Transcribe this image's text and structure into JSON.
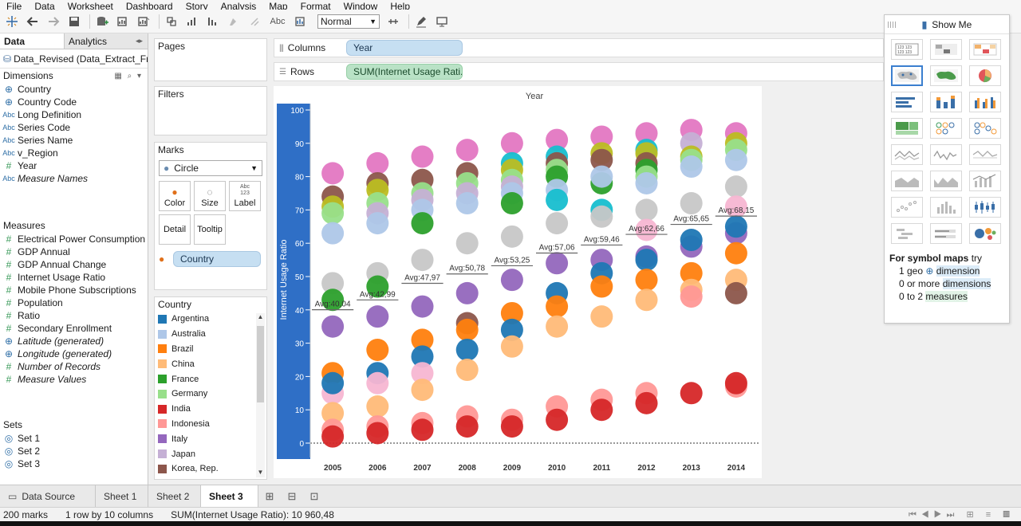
{
  "menu": [
    "File",
    "Data",
    "Worksheet",
    "Dashboard",
    "Story",
    "Analysis",
    "Map",
    "Format",
    "Window",
    "Help"
  ],
  "toolbar": {
    "fit_value": "Normal",
    "text_label": "Abc"
  },
  "data_pane": {
    "tab_data": "Data",
    "tab_analytics": "Analytics",
    "datasource": "Data_Revised (Data_Extract_Fr...",
    "dimensions_title": "Dimensions",
    "dimensions": [
      {
        "type": "geo",
        "name": "Country",
        "italic": false
      },
      {
        "type": "geo",
        "name": "Country Code",
        "italic": false
      },
      {
        "type": "abc",
        "name": "Long Definition",
        "italic": false
      },
      {
        "type": "abc",
        "name": "Series Code",
        "italic": false
      },
      {
        "type": "abc",
        "name": "Series Name",
        "italic": false
      },
      {
        "type": "abc",
        "name": "v_Region",
        "italic": false
      },
      {
        "type": "num",
        "name": "Year",
        "italic": false
      },
      {
        "type": "abc",
        "name": "Measure Names",
        "italic": true
      }
    ],
    "measures_title": "Measures",
    "measures": [
      {
        "type": "num",
        "name": "Electrical Power Consumption",
        "italic": false
      },
      {
        "type": "num",
        "name": "GDP Annual",
        "italic": false
      },
      {
        "type": "num",
        "name": "GDP Annual Change",
        "italic": false
      },
      {
        "type": "num",
        "name": "Internet Usage Ratio",
        "italic": false
      },
      {
        "type": "num",
        "name": "Mobile Phone Subscriptions",
        "italic": false
      },
      {
        "type": "num",
        "name": "Population",
        "italic": false
      },
      {
        "type": "num",
        "name": "Ratio",
        "italic": false
      },
      {
        "type": "num",
        "name": "Secondary Enrollment",
        "italic": false
      },
      {
        "type": "geo",
        "name": "Latitude (generated)",
        "italic": true
      },
      {
        "type": "geo",
        "name": "Longitude (generated)",
        "italic": true
      },
      {
        "type": "num",
        "name": "Number of Records",
        "italic": true
      },
      {
        "type": "num",
        "name": "Measure Values",
        "italic": true
      }
    ],
    "sets_title": "Sets",
    "sets": [
      "Set 1",
      "Set 2",
      "Set 3"
    ]
  },
  "cards": {
    "pages": "Pages",
    "filters": "Filters",
    "marks": "Marks",
    "mark_type": "Circle",
    "color": "Color",
    "size": "Size",
    "label": "Label",
    "label_icon": "Abc 123",
    "detail": "Detail",
    "tooltip": "Tooltip",
    "color_field": "Country"
  },
  "legend": {
    "title": "Country",
    "items": [
      {
        "name": "Argentina",
        "color": "#1f77b4"
      },
      {
        "name": "Australia",
        "color": "#aec7e8"
      },
      {
        "name": "Brazil",
        "color": "#ff7f0e"
      },
      {
        "name": "China",
        "color": "#ffbb78"
      },
      {
        "name": "France",
        "color": "#2ca02c"
      },
      {
        "name": "Germany",
        "color": "#98df8a"
      },
      {
        "name": "India",
        "color": "#d62728"
      },
      {
        "name": "Indonesia",
        "color": "#ff9896"
      },
      {
        "name": "Italy",
        "color": "#9467bd"
      },
      {
        "name": "Japan",
        "color": "#c5b0d5"
      },
      {
        "name": "Korea, Rep.",
        "color": "#8c564b"
      }
    ]
  },
  "shelves": {
    "columns_label": "Columns",
    "columns_pill": "Year",
    "rows_label": "Rows",
    "rows_pill": "SUM(Internet Usage Rati.."
  },
  "chart_data": {
    "type": "scatter",
    "title": "Year",
    "ylabel": "Internet Usage Ratio",
    "ylim": [
      0,
      100
    ],
    "yticks": [
      0,
      10,
      20,
      30,
      40,
      50,
      60,
      70,
      80,
      90,
      100
    ],
    "categories": [
      "2005",
      "2006",
      "2007",
      "2008",
      "2009",
      "2010",
      "2011",
      "2012",
      "2013",
      "2014"
    ],
    "averages": [
      40.04,
      42.99,
      47.97,
      50.78,
      53.25,
      57.06,
      59.46,
      62.66,
      65.65,
      68.15
    ],
    "average_labels": [
      "Avg:40,04",
      "Avg:42,99",
      "Avg:47,97",
      "Avg:50,78",
      "Avg:53,25",
      "Avg:57,06",
      "Avg:59,46",
      "Avg:62,66",
      "Avg:65,65",
      "Avg:68,15"
    ],
    "points": [
      {
        "x": "2005",
        "values": [
          {
            "c": "#e377c2",
            "y": 81
          },
          {
            "c": "#8c564b",
            "y": 74
          },
          {
            "c": "#bcbd22",
            "y": 71
          },
          {
            "c": "#98df8a",
            "y": 69
          },
          {
            "c": "#aec7e8",
            "y": 63
          },
          {
            "c": "#c7c7c7",
            "y": 48
          },
          {
            "c": "#2ca02c",
            "y": 43
          },
          {
            "c": "#9467bd",
            "y": 35
          },
          {
            "c": "#ff7f0e",
            "y": 21
          },
          {
            "c": "#f7b6d2",
            "y": 15
          },
          {
            "c": "#1f77b4",
            "y": 18
          },
          {
            "c": "#ffbb78",
            "y": 9
          },
          {
            "c": "#ff9896",
            "y": 4
          },
          {
            "c": "#d62728",
            "y": 2
          }
        ]
      },
      {
        "x": "2006",
        "values": [
          {
            "c": "#e377c2",
            "y": 84
          },
          {
            "c": "#8c564b",
            "y": 78
          },
          {
            "c": "#bcbd22",
            "y": 76
          },
          {
            "c": "#98df8a",
            "y": 72
          },
          {
            "c": "#c5b0d5",
            "y": 69
          },
          {
            "c": "#aec7e8",
            "y": 66
          },
          {
            "c": "#c7c7c7",
            "y": 51
          },
          {
            "c": "#2ca02c",
            "y": 47
          },
          {
            "c": "#9467bd",
            "y": 38
          },
          {
            "c": "#ff7f0e",
            "y": 28
          },
          {
            "c": "#1f77b4",
            "y": 21
          },
          {
            "c": "#f7b6d2",
            "y": 18
          },
          {
            "c": "#ffbb78",
            "y": 11
          },
          {
            "c": "#ff9896",
            "y": 5
          },
          {
            "c": "#d62728",
            "y": 3
          }
        ]
      },
      {
        "x": "2007",
        "values": [
          {
            "c": "#e377c2",
            "y": 86
          },
          {
            "c": "#8c564b",
            "y": 79
          },
          {
            "c": "#98df8a",
            "y": 75
          },
          {
            "c": "#c5b0d5",
            "y": 73
          },
          {
            "c": "#aec7e8",
            "y": 70
          },
          {
            "c": "#2ca02c",
            "y": 66
          },
          {
            "c": "#c7c7c7",
            "y": 55
          },
          {
            "c": "#9467bd",
            "y": 41
          },
          {
            "c": "#ff7f0e",
            "y": 31
          },
          {
            "c": "#1f77b4",
            "y": 26
          },
          {
            "c": "#f7b6d2",
            "y": 21
          },
          {
            "c": "#ffbb78",
            "y": 16
          },
          {
            "c": "#ff9896",
            "y": 6
          },
          {
            "c": "#d62728",
            "y": 4
          }
        ]
      },
      {
        "x": "2008",
        "values": [
          {
            "c": "#e377c2",
            "y": 88
          },
          {
            "c": "#8c564b",
            "y": 81
          },
          {
            "c": "#98df8a",
            "y": 78
          },
          {
            "c": "#c5b0d5",
            "y": 75
          },
          {
            "c": "#aec7e8",
            "y": 72
          },
          {
            "c": "#c7c7c7",
            "y": 60
          },
          {
            "c": "#9467bd",
            "y": 45
          },
          {
            "c": "#8c564b",
            "y": 36
          },
          {
            "c": "#ff7f0e",
            "y": 34
          },
          {
            "c": "#1f77b4",
            "y": 28
          },
          {
            "c": "#ffbb78",
            "y": 22
          },
          {
            "c": "#ff9896",
            "y": 8
          },
          {
            "c": "#d62728",
            "y": 5
          }
        ]
      },
      {
        "x": "2009",
        "values": [
          {
            "c": "#e377c2",
            "y": 90
          },
          {
            "c": "#17becf",
            "y": 84
          },
          {
            "c": "#bcbd22",
            "y": 82
          },
          {
            "c": "#98df8a",
            "y": 79
          },
          {
            "c": "#c5b0d5",
            "y": 77
          },
          {
            "c": "#aec7e8",
            "y": 75
          },
          {
            "c": "#2ca02c",
            "y": 72
          },
          {
            "c": "#c7c7c7",
            "y": 62
          },
          {
            "c": "#9467bd",
            "y": 49
          },
          {
            "c": "#ff7f0e",
            "y": 39
          },
          {
            "c": "#1f77b4",
            "y": 34
          },
          {
            "c": "#ffbb78",
            "y": 29
          },
          {
            "c": "#ff9896",
            "y": 7
          },
          {
            "c": "#d62728",
            "y": 5
          }
        ]
      },
      {
        "x": "2010",
        "values": [
          {
            "c": "#e377c2",
            "y": 91
          },
          {
            "c": "#17becf",
            "y": 86
          },
          {
            "c": "#8c564b",
            "y": 84
          },
          {
            "c": "#98df8a",
            "y": 82
          },
          {
            "c": "#2ca02c",
            "y": 80
          },
          {
            "c": "#aec7e8",
            "y": 76
          },
          {
            "c": "#17becf",
            "y": 73
          },
          {
            "c": "#c7c7c7",
            "y": 66
          },
          {
            "c": "#9467bd",
            "y": 54
          },
          {
            "c": "#1f77b4",
            "y": 45
          },
          {
            "c": "#ff7f0e",
            "y": 41
          },
          {
            "c": "#ffbb78",
            "y": 35
          },
          {
            "c": "#ff9896",
            "y": 11
          },
          {
            "c": "#d62728",
            "y": 7
          }
        ]
      },
      {
        "x": "2011",
        "values": [
          {
            "c": "#e377c2",
            "y": 92
          },
          {
            "c": "#bcbd22",
            "y": 87
          },
          {
            "c": "#8c564b",
            "y": 85
          },
          {
            "c": "#2ca02c",
            "y": 78
          },
          {
            "c": "#aec7e8",
            "y": 80
          },
          {
            "c": "#17becf",
            "y": 70
          },
          {
            "c": "#c7c7c7",
            "y": 68
          },
          {
            "c": "#9467bd",
            "y": 55
          },
          {
            "c": "#1f77b4",
            "y": 51
          },
          {
            "c": "#ff7f0e",
            "y": 47
          },
          {
            "c": "#ffbb78",
            "y": 38
          },
          {
            "c": "#ff9896",
            "y": 13
          },
          {
            "c": "#d62728",
            "y": 10
          }
        ]
      },
      {
        "x": "2012",
        "values": [
          {
            "c": "#e377c2",
            "y": 93
          },
          {
            "c": "#17becf",
            "y": 88
          },
          {
            "c": "#bcbd22",
            "y": 87
          },
          {
            "c": "#8c564b",
            "y": 84
          },
          {
            "c": "#2ca02c",
            "y": 82
          },
          {
            "c": "#98df8a",
            "y": 80
          },
          {
            "c": "#aec7e8",
            "y": 78
          },
          {
            "c": "#c7c7c7",
            "y": 70
          },
          {
            "c": "#f7b6d2",
            "y": 64
          },
          {
            "c": "#9467bd",
            "y": 56
          },
          {
            "c": "#1f77b4",
            "y": 55
          },
          {
            "c": "#ff7f0e",
            "y": 49
          },
          {
            "c": "#ffbb78",
            "y": 43
          },
          {
            "c": "#ff9896",
            "y": 15
          },
          {
            "c": "#d62728",
            "y": 12
          }
        ]
      },
      {
        "x": "2013",
        "values": [
          {
            "c": "#e377c2",
            "y": 94
          },
          {
            "c": "#c5b0d5",
            "y": 90
          },
          {
            "c": "#bcbd22",
            "y": 86
          },
          {
            "c": "#98df8a",
            "y": 85
          },
          {
            "c": "#aec7e8",
            "y": 83
          },
          {
            "c": "#c7c7c7",
            "y": 72
          },
          {
            "c": "#9467bd",
            "y": 59
          },
          {
            "c": "#1f77b4",
            "y": 61
          },
          {
            "c": "#ff7f0e",
            "y": 51
          },
          {
            "c": "#ffbb78",
            "y": 46
          },
          {
            "c": "#ff9896",
            "y": 44
          },
          {
            "c": "#d62728",
            "y": 15
          }
        ]
      },
      {
        "x": "2014",
        "values": [
          {
            "c": "#e377c2",
            "y": 93
          },
          {
            "c": "#bcbd22",
            "y": 90
          },
          {
            "c": "#98df8a",
            "y": 88
          },
          {
            "c": "#aec7e8",
            "y": 85
          },
          {
            "c": "#c7c7c7",
            "y": 77
          },
          {
            "c": "#f7b6d2",
            "y": 71
          },
          {
            "c": "#9467bd",
            "y": 63
          },
          {
            "c": "#1f77b4",
            "y": 65
          },
          {
            "c": "#ff7f0e",
            "y": 57
          },
          {
            "c": "#ffbb78",
            "y": 49
          },
          {
            "c": "#8c564b",
            "y": 45
          },
          {
            "c": "#ff9896",
            "y": 17
          },
          {
            "c": "#d62728",
            "y": 18
          }
        ]
      }
    ]
  },
  "show_me": {
    "title": "Show Me",
    "hint_title_bold": "For symbol maps",
    "hint_title_rest": " try",
    "hint_line1_pre": "1 geo ",
    "hint_line1_hl": "dimension",
    "hint_line2_pre": "0 or more ",
    "hint_line2_hl": "dimensions",
    "hint_line3_pre": "0 to 2 ",
    "hint_line3_hl": "measures"
  },
  "tabs": {
    "datasource": "Data Source",
    "sheets": [
      "Sheet 1",
      "Sheet 2",
      "Sheet 3"
    ],
    "active": "Sheet 3"
  },
  "status": {
    "marks": "200 marks",
    "dims": "1 row by 10 columns",
    "sum": "SUM(Internet Usage Ratio): 10 960,48"
  },
  "colors": {
    "axis_band": "#2f6fc6",
    "pill_dimension": "#c6dff2",
    "pill_measure": "#b9e2c6"
  }
}
